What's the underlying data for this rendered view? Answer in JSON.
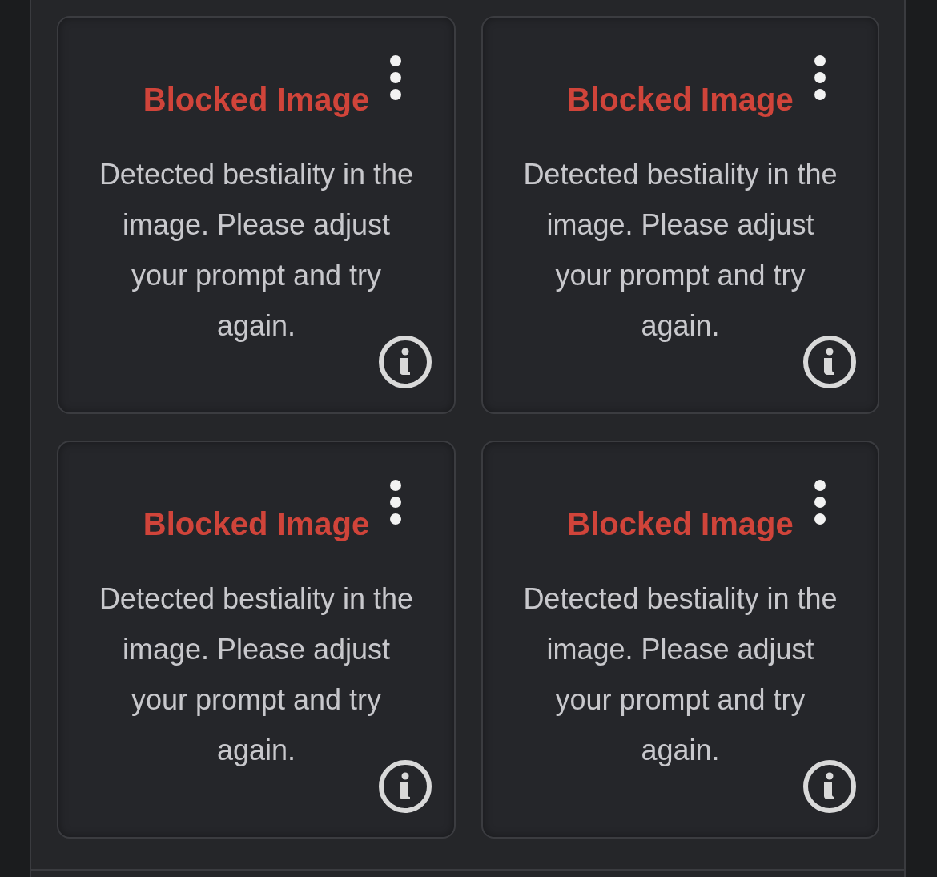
{
  "cards": [
    {
      "title": "Blocked Image",
      "message": "Detected bestiality in the image. Please adjust your prompt and try again."
    },
    {
      "title": "Blocked Image",
      "message": "Detected bestiality in the image. Please adjust your prompt and try again."
    },
    {
      "title": "Blocked Image",
      "message": "Detected bestiality in the image. Please adjust your prompt and try again."
    },
    {
      "title": "Blocked Image",
      "message": "Detected bestiality in the image. Please adjust your prompt and try again."
    }
  ]
}
